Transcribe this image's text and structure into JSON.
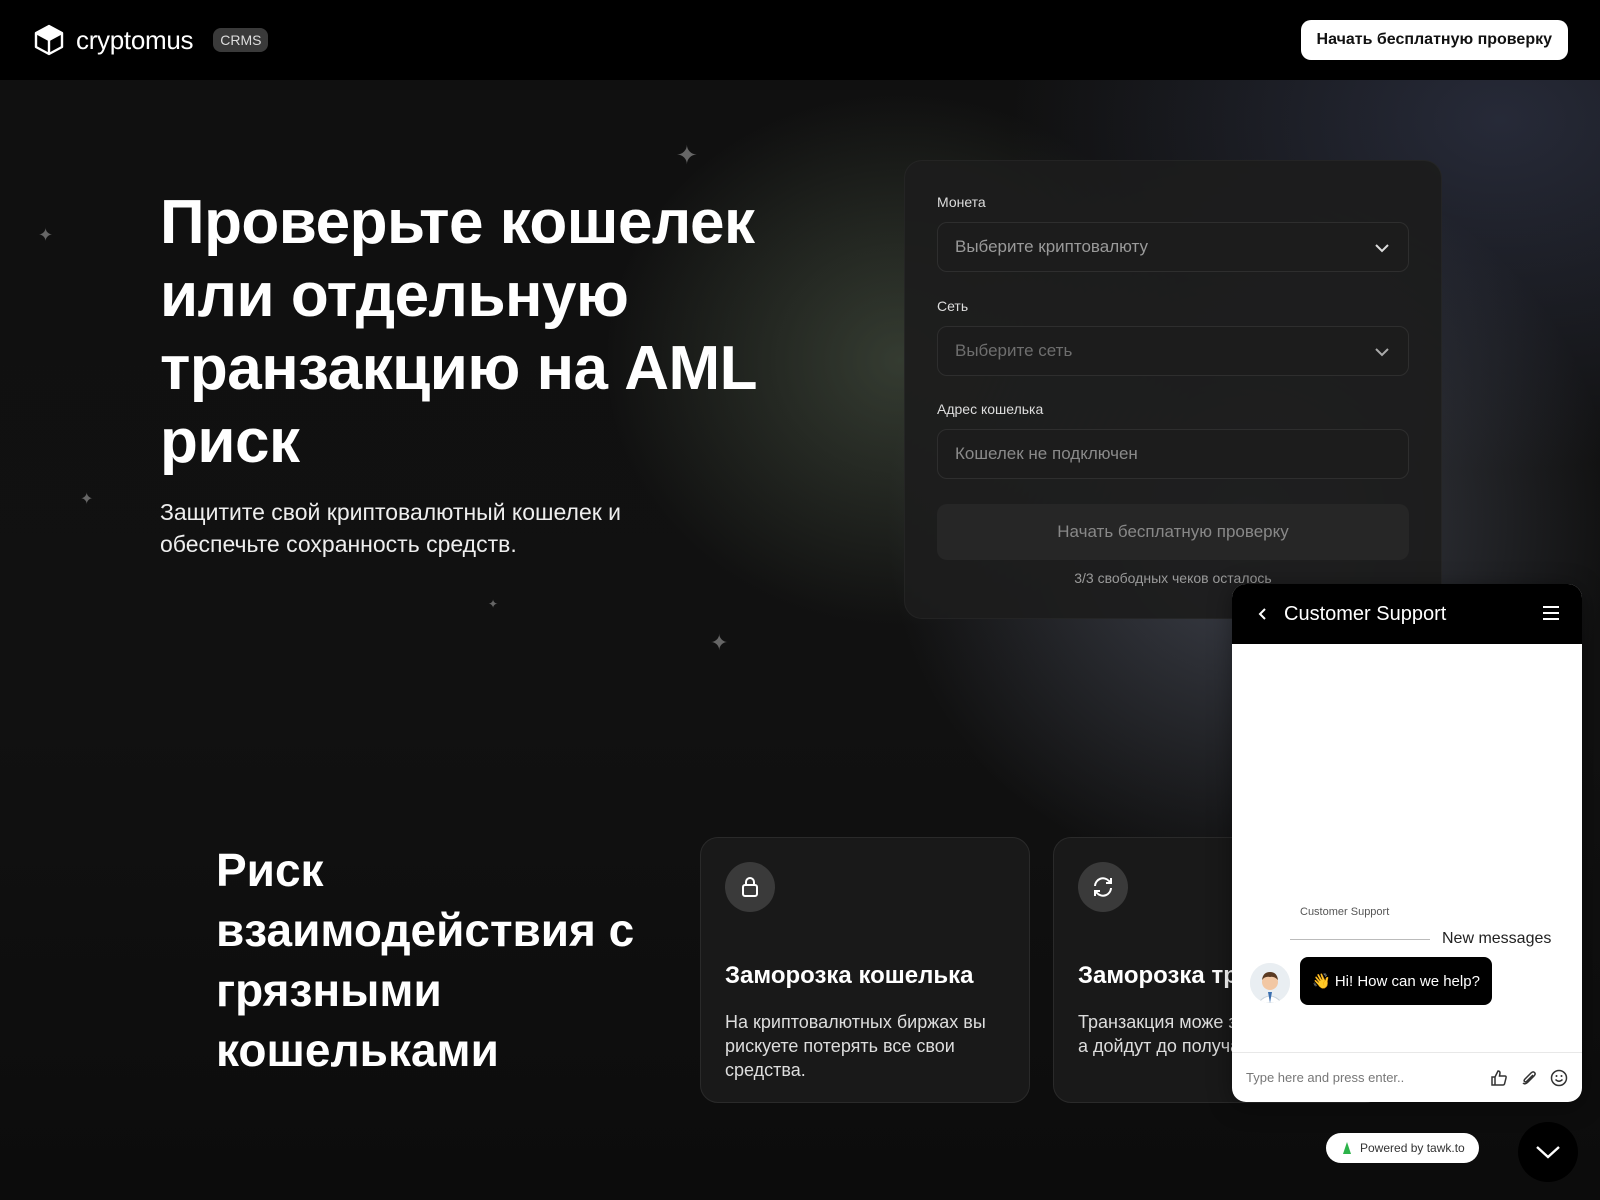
{
  "header": {
    "brand": "cryptomus",
    "badge": "CRMS",
    "cta_label": "Начать бесплатную проверку"
  },
  "hero": {
    "title": "Проверьте кошелек или отдельную транзакцию на AML риск",
    "subtitle": "Защитите свой криптовалютный кошелек и обеспечьте сохранность средств."
  },
  "form": {
    "coin_label": "Монета",
    "coin_placeholder": "Выберите криптовалюту",
    "network_label": "Сеть",
    "network_placeholder": "Выберите сеть",
    "address_label": "Адрес кошелька",
    "address_placeholder": "Кошелек не подключен",
    "submit_label": "Начать бесплатную проверку",
    "free_checks_note": "3/3 свободных чеков осталось"
  },
  "risk_section": {
    "title": "Риск взаимодействия с грязными кошельками",
    "cards": [
      {
        "icon": "lock-icon",
        "title": "Заморозка кошелька",
        "text": "На криптовалютных биржах вы рискуете потерять все свои средства."
      },
      {
        "icon": "refresh-icon",
        "title": "Заморозка тр",
        "text": "Транзакция може заблокирована, а дойдут до получа"
      }
    ]
  },
  "chat": {
    "title": "Customer Support",
    "agent_name": "Customer Support",
    "new_messages": "New messages",
    "message": "👋 Hi! How can we help?",
    "input_placeholder": "Type here and press enter..",
    "powered_by": "Powered by tawk.to"
  }
}
